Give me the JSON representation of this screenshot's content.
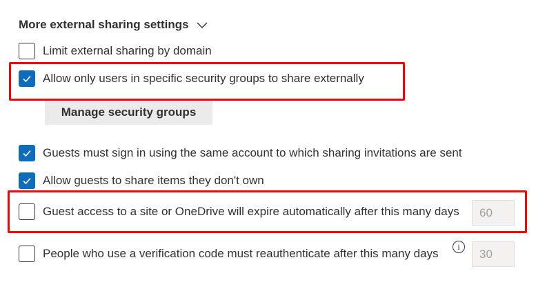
{
  "section": {
    "title": "More external sharing settings",
    "expand_icon": "chevron-down-icon"
  },
  "settings": {
    "limit_by_domain": {
      "label": "Limit external sharing by domain",
      "checked": false
    },
    "security_groups_only": {
      "label": "Allow only users in specific security groups to share externally",
      "checked": true
    },
    "manage_security_groups_label": "Manage security groups",
    "guests_same_account": {
      "label": "Guests must sign in using the same account to which sharing invitations are sent",
      "checked": true
    },
    "guests_share_items": {
      "label": "Allow guests to share items they don't own",
      "checked": true
    },
    "guest_access_expire": {
      "label": "Guest access to a site or OneDrive will expire automatically after this many days",
      "checked": false,
      "days_value": "60"
    },
    "verification_reauth": {
      "label": "People who use a verification code must reauthenticate after this many days",
      "checked": false,
      "days_value": "30",
      "info_icon": "info-icon"
    }
  },
  "colors": {
    "checkbox_checked": "#0f6cbd",
    "highlight": "#ff0000",
    "button_bg": "#ebebeb"
  }
}
